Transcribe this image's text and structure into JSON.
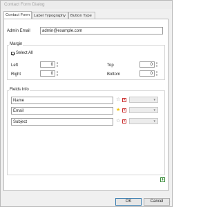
{
  "window": {
    "title": "Contact Form Dialog"
  },
  "tabs": [
    {
      "label": "Contact Form"
    },
    {
      "label": "Label Typography"
    },
    {
      "label": "Button Type"
    }
  ],
  "admin_email": {
    "label": "Admin Email",
    "value": "admin@example.com"
  },
  "margin": {
    "title": "Margin",
    "select_all_label": "Select All",
    "left": {
      "label": "Left",
      "value": "0"
    },
    "right": {
      "label": "Right",
      "value": "0"
    },
    "top": {
      "label": "Top",
      "value": "0"
    },
    "bottom": {
      "label": "Bottom",
      "value": "0"
    }
  },
  "fields_info": {
    "title": "Fields Info",
    "rows": [
      {
        "name": "Name",
        "required": false
      },
      {
        "name": "Email",
        "required": true
      },
      {
        "name": "Subject",
        "required": false
      }
    ]
  },
  "buttons": {
    "ok": "OK",
    "cancel": "Cancel"
  },
  "colors": {
    "star_active": "#f2c200",
    "star_inactive": "#8f8f8f",
    "delete": "#cc3333",
    "add": "#2e8a2e"
  },
  "icons": [
    "star-icon",
    "delete-icon",
    "chevron-down-icon",
    "add-icon",
    "resize-grip-icon"
  ]
}
